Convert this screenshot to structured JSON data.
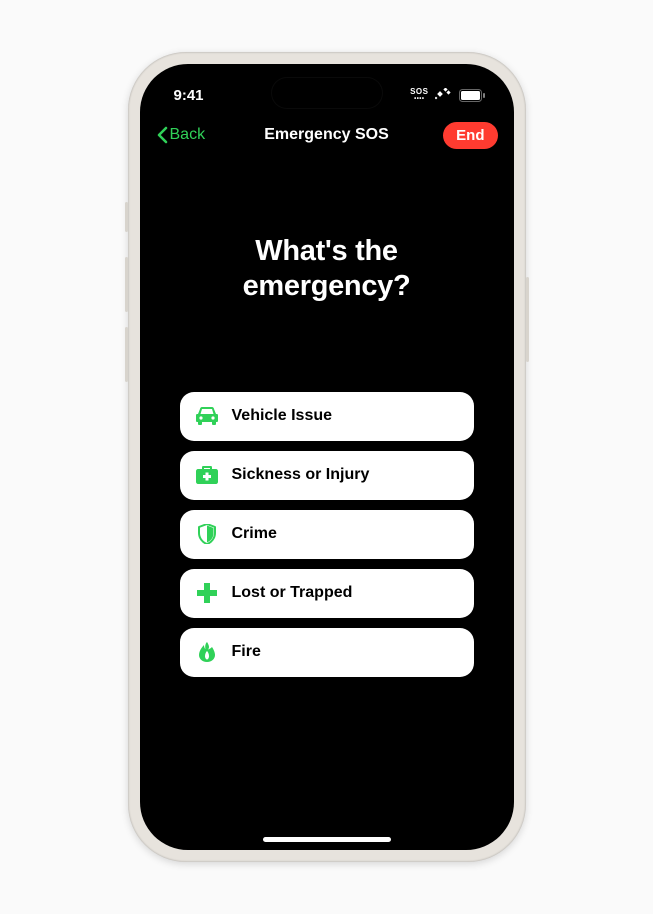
{
  "status": {
    "time": "9:41",
    "sos_label": "SOS"
  },
  "nav": {
    "back_label": "Back",
    "title": "Emergency SOS",
    "end_label": "End"
  },
  "heading": "What's the emergency?",
  "options": [
    {
      "icon": "car",
      "label": "Vehicle Issue"
    },
    {
      "icon": "medkit",
      "label": "Sickness or Injury"
    },
    {
      "icon": "shield",
      "label": "Crime"
    },
    {
      "icon": "plus",
      "label": "Lost or Trapped"
    },
    {
      "icon": "flame",
      "label": "Fire"
    }
  ],
  "colors": {
    "accent_green": "#30d158",
    "accent_red": "#ff3b30",
    "bg": "#000000",
    "card": "#ffffff"
  }
}
